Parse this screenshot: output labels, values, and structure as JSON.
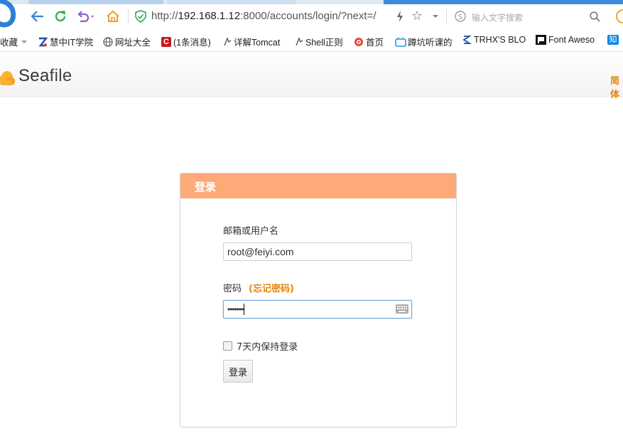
{
  "browser": {
    "address_url_prefix": "http://",
    "address_host": "192.168.1.12",
    "address_path": ":8000/accounts/login/?next=/",
    "search_placeholder": "输入文字搜索"
  },
  "bookmarks": [
    {
      "label": "收藏",
      "icon": "dropdown-icon"
    },
    {
      "label": "慧中IT学院",
      "icon": "huizhong-icon"
    },
    {
      "label": "网址大全",
      "icon": "globe-icon"
    },
    {
      "label": "(1条消息)",
      "icon": "csdn-icon"
    },
    {
      "label": "详解Tomcat",
      "icon": "bookmark-icon"
    },
    {
      "label": "Shell正则",
      "icon": "bookmark-icon"
    },
    {
      "label": "首页",
      "icon": "weibo-icon"
    },
    {
      "label": "蹲坑听课的",
      "icon": "bilibili-icon"
    },
    {
      "label": "TRHX'S BLO",
      "icon": "blog-icon"
    },
    {
      "label": "Font Aweso",
      "icon": "flag-icon"
    },
    {
      "label": "知",
      "icon": "zhihu-icon"
    }
  ],
  "site": {
    "logo_sea": "Sea",
    "logo_file": "file",
    "lang_label": "简体"
  },
  "login": {
    "title": "登录",
    "username_label": "邮箱或用户名",
    "username_value": "root@feiyi.com",
    "password_label": "密码",
    "forgot_label": "(忘记密码)",
    "password_value": "•••••••",
    "remember_label": "7天内保持登录",
    "submit_label": "登录"
  },
  "colors": {
    "panel_header": "#fdaa78",
    "accent": "#eb8205",
    "logo_cloud": "#f9b233"
  }
}
